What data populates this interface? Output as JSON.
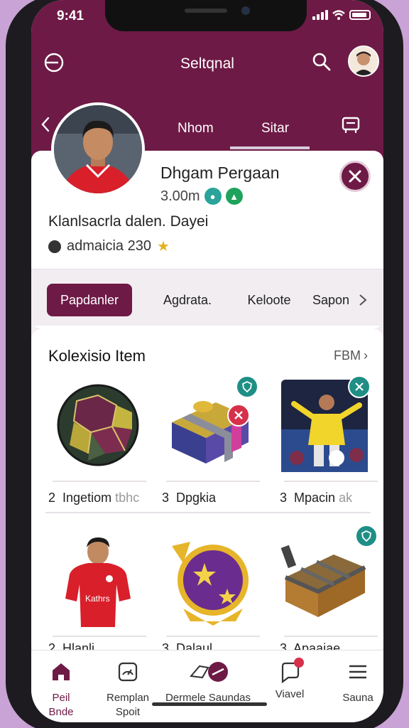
{
  "status_bar": {
    "time": "9:41"
  },
  "app_bar": {
    "title": "Seltqnal"
  },
  "header_tabs": [
    {
      "label": "Nhom"
    },
    {
      "label": "Sitar"
    }
  ],
  "profile": {
    "name": "Dhgam Pergaan",
    "stats": "3.00m",
    "bio": "Klanlsacrla dalen. Dayei",
    "meta": "admaicia 230"
  },
  "segments": [
    {
      "label": "Papdanler",
      "active": true
    },
    {
      "label": "Agdrata.",
      "active": false
    },
    {
      "label": "Keloote",
      "active": false
    },
    {
      "label": "Sapon",
      "active": false
    }
  ],
  "collection": {
    "title": "Kolexisio Item",
    "more": "FBM",
    "items": [
      {
        "count": "2",
        "name": "Ingetiom",
        "extra": "tbhc",
        "icon": "soccer-ball-icon"
      },
      {
        "count": "3",
        "name": "Dpgkia",
        "extra": "",
        "icon": "gift-box-icon"
      },
      {
        "count": "3",
        "name": "Mpacin",
        "extra": "ak",
        "icon": "goalkeeper-card-icon"
      },
      {
        "count": "2",
        "name": "Hlanli",
        "extra": "",
        "icon": "player-kit-icon"
      },
      {
        "count": "3",
        "name": "Dalaul",
        "extra": "",
        "icon": "star-trophy-icon"
      },
      {
        "count": "3",
        "name": "Apaaiae",
        "extra": "",
        "icon": "treasure-chest-icon"
      }
    ]
  },
  "bottom_nav": [
    {
      "label": "Peil\nBnde",
      "icon": "home-icon",
      "active": true
    },
    {
      "label": "Remplan\nSpoit",
      "icon": "gauge-icon",
      "active": false
    },
    {
      "label": "Dermele Saundas",
      "icon": "rocket-icon",
      "active": false
    },
    {
      "label": "Viavel",
      "icon": "chat-icon",
      "active": false
    },
    {
      "label": "Sauna",
      "icon": "menu-icon",
      "active": false
    }
  ],
  "colors": {
    "brand": "#6e1a46",
    "accent_teal": "#1f8f86",
    "accent_red": "#d6304a",
    "accent_green": "#1fa35c"
  }
}
